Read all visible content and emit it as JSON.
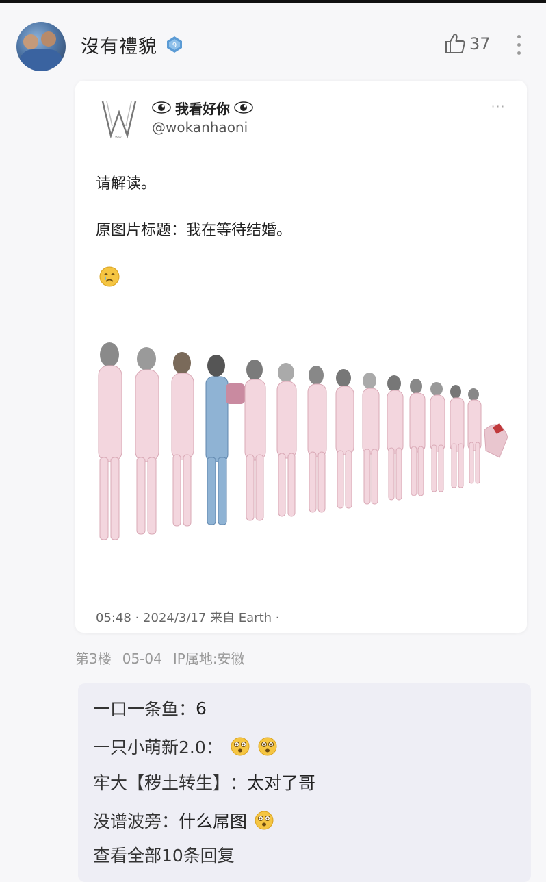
{
  "post": {
    "username": "沒有禮貌",
    "like_count": "37"
  },
  "tweet": {
    "name": "我看好你",
    "handle": "@wokanhaoni",
    "line1": "请解读。",
    "line2": "原图片标题：我在等待结婚。",
    "meta": "05:48 · 2024/3/17 来自 Earth ·"
  },
  "floor": {
    "floor": "第3楼",
    "date": "05-04",
    "ip": "IP属地:安徽"
  },
  "replies": [
    {
      "author": "一口一条鱼",
      "text": "6",
      "emoji_count": 0
    },
    {
      "author": "一只小萌新2.0",
      "text": "",
      "emoji_count": 2
    },
    {
      "author": "牢大【秽土转生】",
      "text": "太对了哥",
      "emoji_count": 0
    },
    {
      "author": "没谱波旁",
      "text": "什么屌图",
      "emoji_count": 1
    }
  ],
  "view_all": "查看全部10条回复",
  "colors": {
    "background": "#f7f7f9",
    "badge_blue": "#5b9bd5",
    "reply_box": "#eeeef5",
    "emoji_yellow": "#f5c542"
  },
  "icons": [
    "verified-badge-icon",
    "thumbs-up-icon",
    "more-vertical-icon",
    "eye-icon",
    "more-horizontal-icon",
    "crying-face-emoji",
    "flushed-face-emoji"
  ]
}
